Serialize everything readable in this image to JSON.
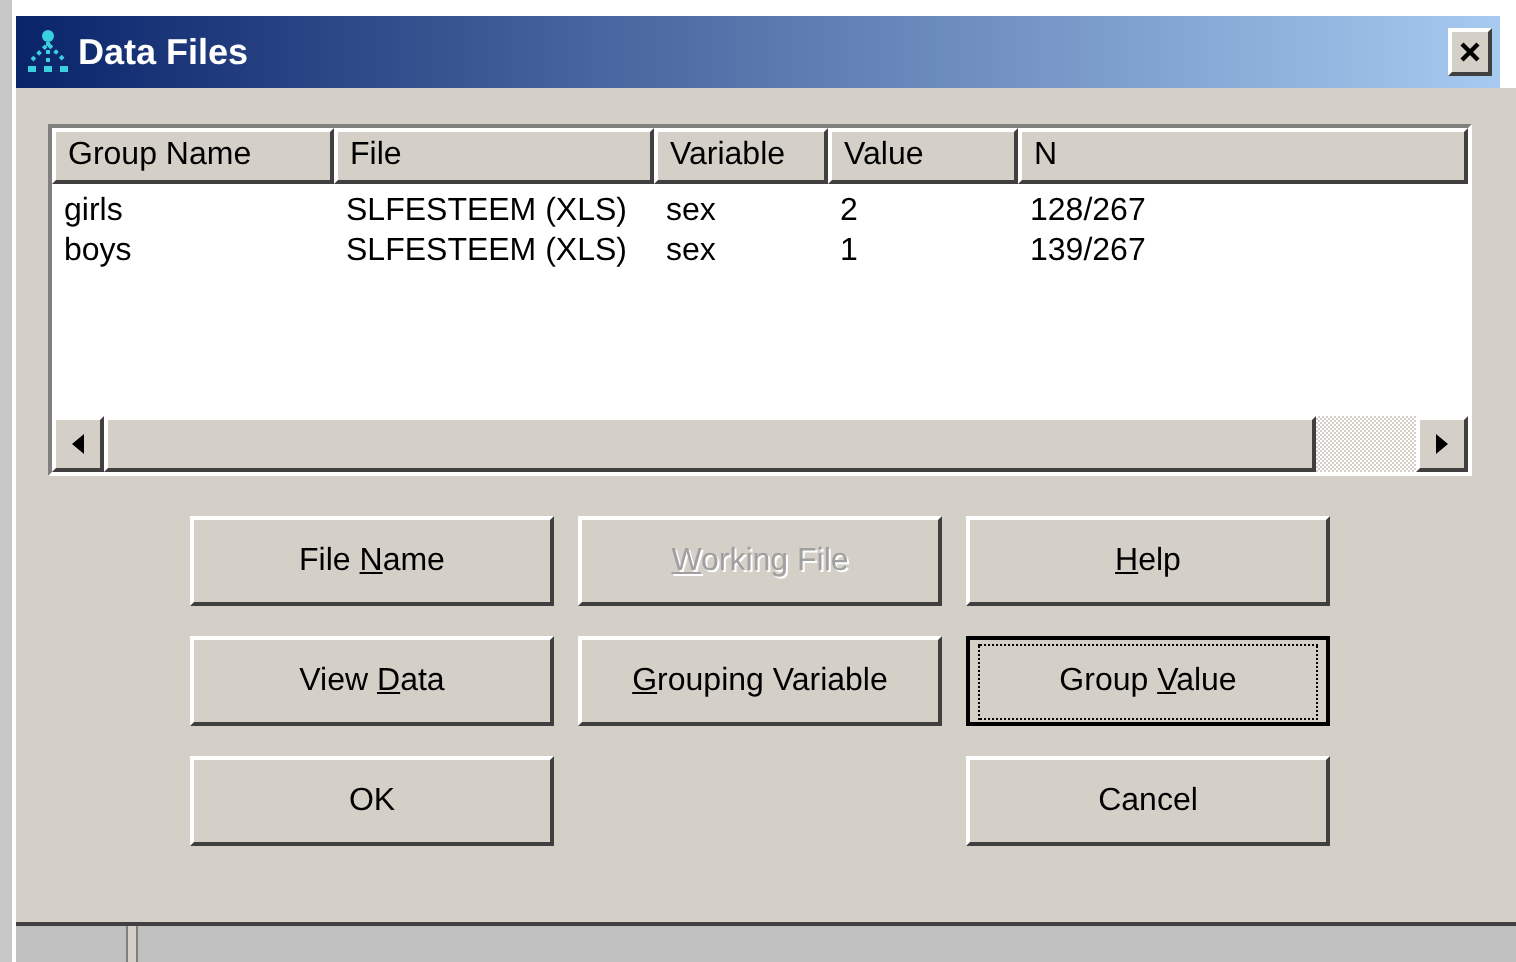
{
  "window": {
    "title": "Data Files"
  },
  "table": {
    "columns": [
      "Group Name",
      "File",
      "Variable",
      "Value",
      "N"
    ],
    "rows": [
      [
        "girls",
        "SLFESTEEM (XLS)",
        "sex",
        "2",
        "128/267"
      ],
      [
        "boys",
        "SLFESTEEM (XLS)",
        "sex",
        "1",
        "139/267"
      ]
    ]
  },
  "button_rows": [
    [
      {
        "before": "File ",
        "key": "N",
        "after": "ame",
        "disabled": false,
        "default": false
      },
      {
        "key": "W",
        "after": "orking File",
        "disabled": true,
        "default": false
      },
      {
        "key": "H",
        "after": "elp",
        "disabled": false,
        "default": false
      }
    ],
    [
      {
        "before": "View ",
        "key": "D",
        "after": "ata",
        "disabled": false,
        "default": false
      },
      {
        "key": "G",
        "after": "rouping Variable",
        "disabled": false,
        "default": false
      },
      {
        "before": "Group ",
        "key": "V",
        "after": "alue",
        "disabled": false,
        "default": true
      }
    ],
    [
      {
        "before": "OK",
        "disabled": false,
        "default": false
      },
      {
        "before": "Cancel",
        "disabled": false,
        "default": false
      }
    ]
  ]
}
